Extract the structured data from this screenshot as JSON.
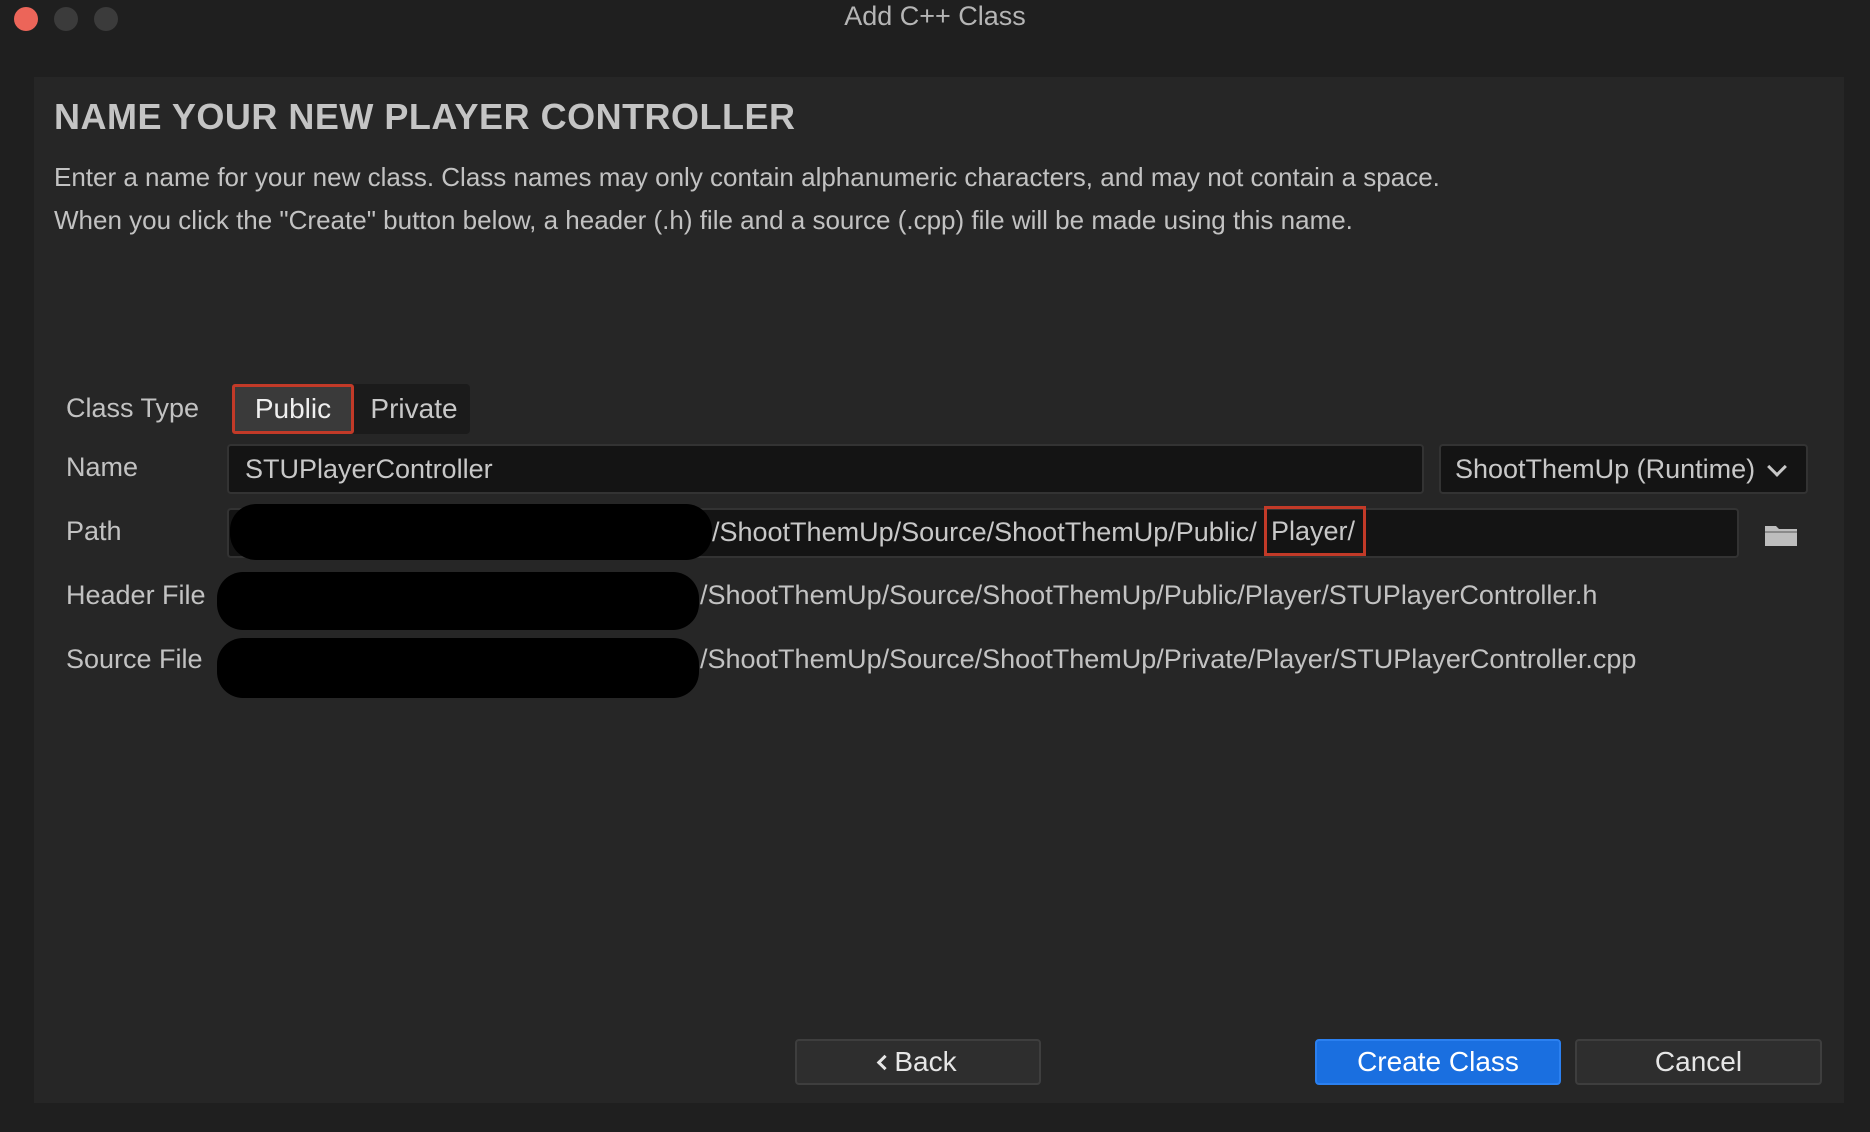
{
  "window": {
    "title": "Add C++ Class"
  },
  "header": {
    "heading": "NAME YOUR NEW PLAYER CONTROLLER",
    "description_line1": "Enter a name for your new class. Class names may only contain alphanumeric characters, and may not contain a space.",
    "description_line2": "When you click the \"Create\" button below, a header (.h) file and a source (.cpp) file will be made using this name."
  },
  "form": {
    "class_type_label": "Class Type",
    "class_type_options": [
      "Public",
      "Private"
    ],
    "class_type_selected": "Public",
    "name_label": "Name",
    "name_value": "STUPlayerController",
    "module_value": "ShootThemUp (Runtime)",
    "path_label": "Path",
    "path_value": "/ShootThemUp/Source/ShootThemUp/Public/",
    "path_highlight": "Player/",
    "header_label": "Header File",
    "header_value": "/ShootThemUp/Source/ShootThemUp/Public/Player/STUPlayerController.h",
    "source_label": "Source File",
    "source_value": "/ShootThemUp/Source/ShootThemUp/Private/Player/STUPlayerController.cpp"
  },
  "buttons": {
    "back": "Back",
    "create": "Create Class",
    "cancel": "Cancel"
  },
  "colors": {
    "accent": "#1a6fe0",
    "highlight": "#c23a28",
    "close": "#ec6559"
  },
  "icons": {
    "folder": "folder-icon",
    "chevron": "chevron-down-icon",
    "back": "chevron-left-icon"
  }
}
